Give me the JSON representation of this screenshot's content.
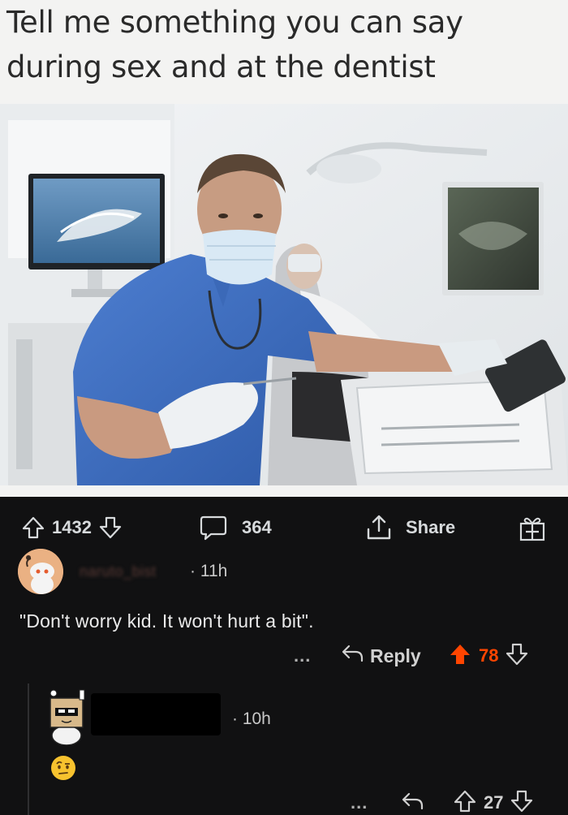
{
  "post": {
    "caption_line1": "Tell me something you can say",
    "caption_line2": "during sex and at the dentist",
    "upvotes": "1432",
    "comments": "364",
    "share_label": "Share"
  },
  "comment1": {
    "username": "naruto_bist",
    "time": "11h",
    "body": "\"Don't worry kid. It won't hurt a bit\".",
    "more": "...",
    "reply_label": "Reply",
    "votes": "78",
    "vote_color": "#ff4500"
  },
  "comment2": {
    "time": "10h",
    "body_emoji": "face-with-raised-eyebrow",
    "more": "...",
    "votes": "27"
  },
  "colors": {
    "background": "#111112",
    "upvote_active": "#ff4500",
    "text": "#d7dadc"
  }
}
